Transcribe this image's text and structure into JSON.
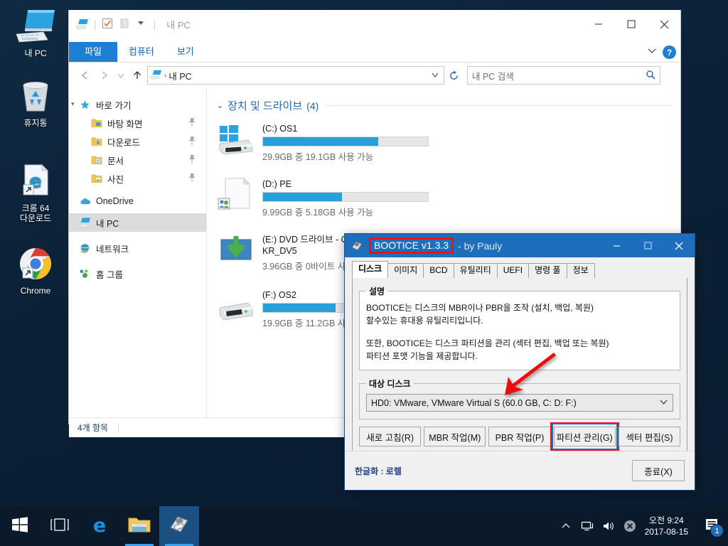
{
  "desktop": {
    "icons": [
      {
        "name": "내 PC",
        "icon": "computer-icon"
      },
      {
        "name": "휴지통",
        "icon": "recycle-bin-icon"
      },
      {
        "name": "크롬 64\n다운로드",
        "line1": "크롬 64",
        "line2": "다운로드",
        "icon": "edge-shortcut-icon"
      },
      {
        "name": "Chrome",
        "line1": "Chrome",
        "line2": "",
        "icon": "chrome-icon"
      }
    ]
  },
  "explorer": {
    "quick_access_title": "내 PC",
    "ribbon_tabs": [
      {
        "label": "파일",
        "active": true
      },
      {
        "label": "컴퓨터",
        "active": false
      },
      {
        "label": "보기",
        "active": false
      }
    ],
    "help_label": "?",
    "address": {
      "crumb": "내 PC",
      "separator": "›"
    },
    "search": {
      "placeholder": "내 PC 검색",
      "value": ""
    },
    "nav": {
      "items": [
        {
          "label": "바로 가기",
          "icon": "star-icon",
          "indent": false,
          "pinned": false,
          "selected": false
        },
        {
          "label": "바탕 화면",
          "icon": "desktop-folder-icon",
          "indent": true,
          "pinned": true,
          "selected": false
        },
        {
          "label": "다운로드",
          "icon": "downloads-folder-icon",
          "indent": true,
          "pinned": true,
          "selected": false
        },
        {
          "label": "문서",
          "icon": "documents-folder-icon",
          "indent": true,
          "pinned": true,
          "selected": false
        },
        {
          "label": "사진",
          "icon": "pictures-folder-icon",
          "indent": true,
          "pinned": true,
          "selected": false
        },
        {
          "label": "OneDrive",
          "icon": "onedrive-icon",
          "indent": false,
          "pinned": false,
          "selected": false
        },
        {
          "label": "내 PC",
          "icon": "computer-icon",
          "indent": false,
          "pinned": false,
          "selected": true
        },
        {
          "label": "네트워크",
          "icon": "network-icon",
          "indent": false,
          "pinned": false,
          "selected": false
        },
        {
          "label": "홈 그룹",
          "icon": "homegroup-icon",
          "indent": false,
          "pinned": false,
          "selected": false
        }
      ]
    },
    "group": {
      "title": "장치 및 드라이브",
      "count": "(4)"
    },
    "drives": [
      {
        "name": "(C:) OS1",
        "free_text": "29.9GB 중 19.1GB 사용 가능",
        "used_percent": 70,
        "icon": "windows-drive-icon",
        "show_bar": true
      },
      {
        "name": "(D:) PE",
        "free_text": "9.99GB 중 5.18GB 사용 가능",
        "used_percent": 48,
        "icon": "shared-drive-icon",
        "show_bar": true
      },
      {
        "name": "(E:) DVD 드라이브 - CPRA_X64FRE_KO-KR_DV5",
        "free_text": "3.96GB 중 0바이트 사용 가능",
        "used_percent": 100,
        "icon": "dvd-drive-icon",
        "show_bar": false
      },
      {
        "name": "(F:) OS2",
        "free_text": "19.9GB 중 11.2GB 사용 가능",
        "used_percent": 44,
        "icon": "hard-drive-icon",
        "show_bar": true
      }
    ],
    "status": "4개 항목"
  },
  "bootice": {
    "title_highlight": "BOOTICE v1.3.3",
    "title_rest": "- by Pauly",
    "tabs": [
      {
        "label": "디스크",
        "active": true
      },
      {
        "label": "이미지",
        "active": false
      },
      {
        "label": "BCD",
        "active": false
      },
      {
        "label": "유틸리티",
        "active": false
      },
      {
        "label": "UEFI",
        "active": false
      },
      {
        "label": "명령 풀",
        "active": false
      },
      {
        "label": "정보",
        "active": false
      }
    ],
    "description": {
      "legend": "설명",
      "paragraph1_line1": "BOOTICE는 디스크의 MBR이나 PBR을 조작 (설치, 백업, 복원)",
      "paragraph1_line2": "할수있는 휴대용 유틸리티입니다.",
      "paragraph2_line1": "또한, BOOTICE는 디스크 파티션을 관리 (섹터 편집, 백업 또는 복원)",
      "paragraph2_line2": "파티션 포맷 기능을 제공합니다."
    },
    "target_disk": {
      "legend": "대상 디스크",
      "selected": "HD0: VMware, VMware Virtual S (60.0 GB, C: D: F:)"
    },
    "buttons": [
      {
        "label": "새로 고침(R)",
        "highlighted": false
      },
      {
        "label": "MBR 작업(M)",
        "highlighted": false
      },
      {
        "label": "PBR 작업(P)",
        "highlighted": false
      },
      {
        "label": "파티션 관리(G)",
        "highlighted": true
      },
      {
        "label": "섹터 편집(S)",
        "highlighted": false
      }
    ],
    "credit": "한글화 : 로렐",
    "exit_label": "종료(X)",
    "accent_highlight": "#ee1111",
    "accent_focus": "#1b6fc4",
    "titlebar_color": "#1d6fbd"
  },
  "taskbar": {
    "items": [
      {
        "icon": "start-icon",
        "active": false,
        "running": false
      },
      {
        "icon": "task-view-icon",
        "active": false,
        "running": false
      },
      {
        "icon": "edge-icon",
        "active": false,
        "running": false
      },
      {
        "icon": "file-explorer-icon",
        "active": false,
        "running": true
      },
      {
        "icon": "bootice-icon",
        "active": true,
        "running": true
      }
    ],
    "tray": [
      {
        "icon": "show-hidden-icons-chevron"
      },
      {
        "icon": "network-icon"
      },
      {
        "icon": "volume-icon"
      },
      {
        "icon": "error-icon"
      }
    ],
    "clock": {
      "time": "오전 9:24",
      "date": "2017-08-15"
    },
    "notification": {
      "icon": "action-center-icon",
      "count": "1"
    }
  }
}
